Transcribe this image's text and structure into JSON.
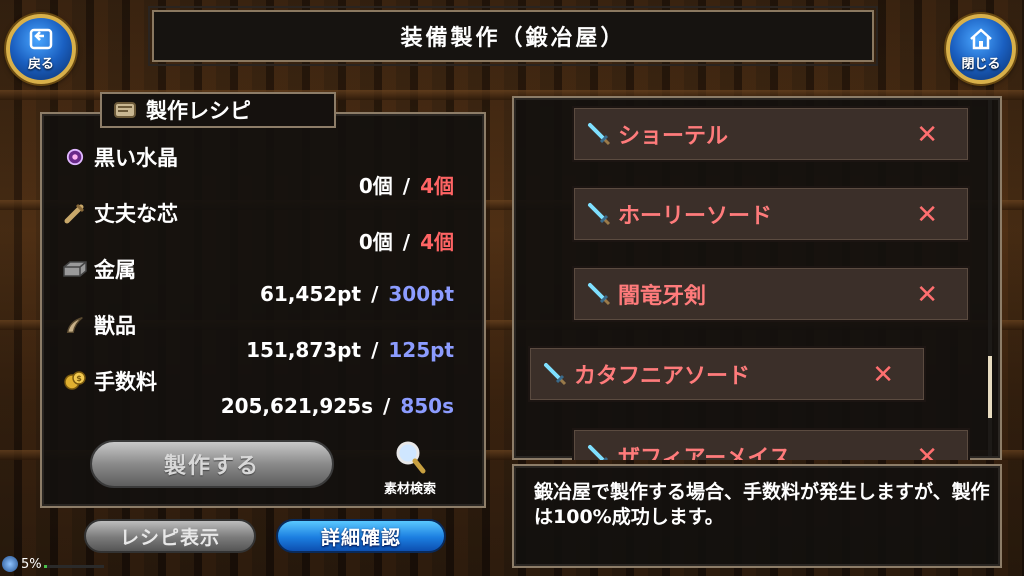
{
  "header": {
    "title": "装備製作（鍛冶屋）",
    "back_label": "戻る",
    "close_label": "閉じる"
  },
  "recipe": {
    "title": "製作レシピ",
    "materials": [
      {
        "name": "黒い水晶",
        "owned": "0個",
        "required": "4個",
        "icon": "purple-gem-icon"
      },
      {
        "name": "丈夫な芯",
        "owned": "0個",
        "required": "4個",
        "icon": "core-icon"
      },
      {
        "name": "金属",
        "owned": "61,452pt",
        "required": "300pt",
        "icon": "metal-icon"
      },
      {
        "name": "獣品",
        "owned": "151,873pt",
        "required": "125pt",
        "icon": "claw-icon"
      },
      {
        "name": "手数料",
        "owned": "205,621,925s",
        "required": "850s",
        "icon": "coins-icon"
      }
    ],
    "separator": "/",
    "craft_label": "製作する",
    "search_label": "素材検索"
  },
  "buttons": {
    "recipe_view": "レシピ表示",
    "detail_check": "詳細確認"
  },
  "equipment": [
    {
      "name": "ショーテル",
      "remove": "✕"
    },
    {
      "name": "ホーリーソード",
      "remove": "✕"
    },
    {
      "name": "闇竜牙剣",
      "remove": "✕"
    },
    {
      "name": "カタフニアソード",
      "remove": "✕"
    },
    {
      "name": "ザフィアーメイス",
      "remove": "✕"
    }
  ],
  "message": "鍛冶屋で製作する場合、手数料が発生しますが、製作は100%成功します。",
  "status": {
    "battery": "5%",
    "battery_level": 0.05
  },
  "colors": {
    "required_item": "#ff6464",
    "required_points": "#8c9cff",
    "equipment_name": "#ff7b7b"
  }
}
